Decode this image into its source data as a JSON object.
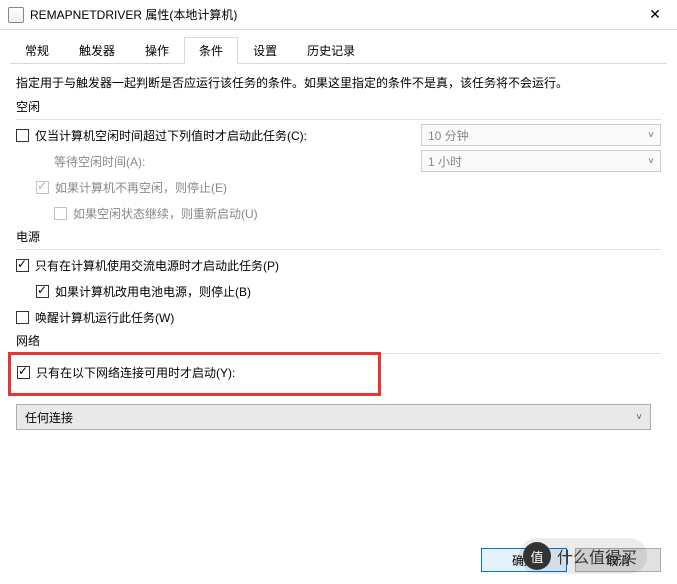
{
  "title": "REMAPNETDRIVER 属性(本地计算机)",
  "tabs": [
    "常规",
    "触发器",
    "操作",
    "条件",
    "设置",
    "历史记录"
  ],
  "active_tab": "条件",
  "description": "指定用于与触发器一起判断是否应运行该任务的条件。如果这里指定的条件不是真，该任务将不会运行。",
  "idle": {
    "section": "空闲",
    "only_if_idle": "仅当计算机空闲时间超过下列值时才启动此任务(C):",
    "only_if_idle_hotkey": "C",
    "wait_label": "等待空闲时间(A):",
    "wait_hotkey": "A",
    "stop_if_not_idle": "如果计算机不再空闲，则停止(E)",
    "stop_hotkey": "E",
    "restart_if_idle": "如果空闲状态继续，则重新启动(U)",
    "restart_hotkey": "U",
    "duration_value": "10 分钟",
    "wait_value": "1 小时"
  },
  "power": {
    "section": "电源",
    "ac_only": "只有在计算机使用交流电源时才启动此任务(P)",
    "ac_hotkey": "P",
    "stop_on_battery": "如果计算机改用电池电源，则停止(B)",
    "stop_hotkey": "B",
    "wake": "唤醒计算机运行此任务(W)",
    "wake_hotkey": "W"
  },
  "network": {
    "section": "网络",
    "only_if_network": "只有在以下网络连接可用时才启动(Y):",
    "network_hotkey": "Y",
    "selected": "任何连接"
  },
  "buttons": {
    "ok": "确定",
    "cancel": "取消"
  },
  "watermark": {
    "badge": "值",
    "text": "什么值得买"
  }
}
